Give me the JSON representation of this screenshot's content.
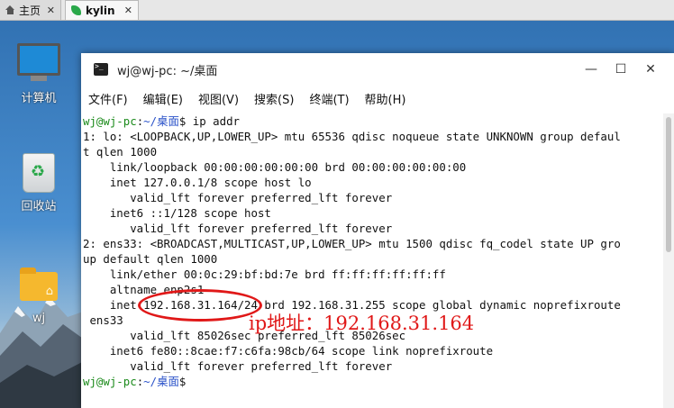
{
  "vm_tabs": {
    "home_label": "主页",
    "kylin_label": "kylin",
    "close_glyph": "✕"
  },
  "desktop_icons": [
    {
      "label": "计算机",
      "icon": "computer-icon"
    },
    {
      "label": "回收站",
      "icon": "trash-icon"
    },
    {
      "label": "wj",
      "icon": "home-folder-icon"
    }
  ],
  "window": {
    "title": "wj@wj-pc: ~/桌面",
    "min_glyph": "—",
    "max_glyph": "☐",
    "close_glyph": "✕"
  },
  "menu": [
    "文件(F)",
    "编辑(E)",
    "视图(V)",
    "搜索(S)",
    "终端(T)",
    "帮助(H)"
  ],
  "terminal": {
    "prompt_user": "wj@wj-pc",
    "prompt_sep": ":",
    "prompt_path": "~/桌面",
    "prompt_dollar": "$",
    "command": " ip addr",
    "lines": [
      "1: lo: <LOOPBACK,UP,LOWER_UP> mtu 65536 qdisc noqueue state UNKNOWN group defaul",
      "t qlen 1000",
      "    link/loopback 00:00:00:00:00:00 brd 00:00:00:00:00:00",
      "    inet 127.0.0.1/8 scope host lo",
      "       valid_lft forever preferred_lft forever",
      "    inet6 ::1/128 scope host",
      "       valid_lft forever preferred_lft forever",
      "2: ens33: <BROADCAST,MULTICAST,UP,LOWER_UP> mtu 1500 qdisc fq_codel state UP gro",
      "up default qlen 1000",
      "    link/ether 00:0c:29:bf:bd:7e brd ff:ff:ff:ff:ff:ff",
      "    altname enp2s1",
      "    inet 192.168.31.164/24 brd 192.168.31.255 scope global dynamic noprefixroute",
      " ens33",
      "       valid_lft 85026sec preferred_lft 85026sec",
      "    inet6 fe80::8cae:f7:c6fa:98cb/64 scope link noprefixroute",
      "       valid_lft forever preferred_lft forever"
    ]
  },
  "annotation": {
    "text": "ip地址：192.168.31.164",
    "color": "#e01818"
  },
  "colors": {
    "prompt_user": "#1a8a1a",
    "prompt_path": "#2a52c9"
  }
}
